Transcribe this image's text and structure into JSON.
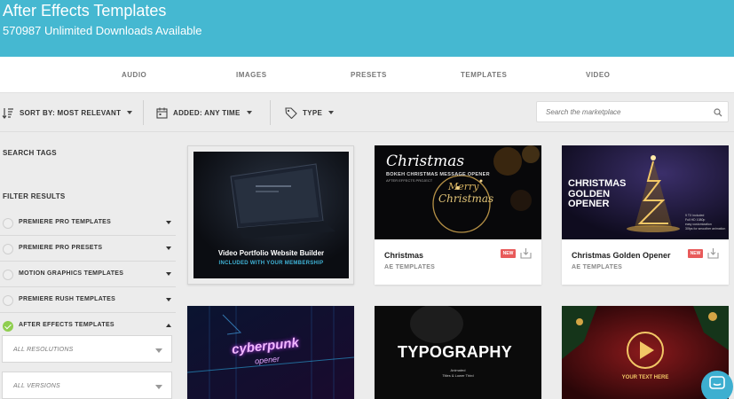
{
  "header": {
    "title": "After Effects Templates",
    "subtitle": "570987 Unlimited Downloads Available"
  },
  "nav": [
    "AUDIO",
    "IMAGES",
    "PRESETS",
    "TEMPLATES",
    "VIDEO"
  ],
  "toolbar": {
    "sort_label": "SORT BY: MOST RELEVANT",
    "added_label": "ADDED: ANY TIME",
    "type_label": "TYPE",
    "search_placeholder": "Search the marketplace"
  },
  "sidebar": {
    "search_tags": "SEARCH TAGS",
    "filter_results": "FILTER RESULTS",
    "filters": [
      {
        "label": "PREMIERE PRO TEMPLATES",
        "checked": false
      },
      {
        "label": "PREMIERE PRO PRESETS",
        "checked": false
      },
      {
        "label": "MOTION GRAPHICS TEMPLATES",
        "checked": false
      },
      {
        "label": "PREMIERE RUSH TEMPLATES",
        "checked": false
      },
      {
        "label": "AFTER EFFECTS TEMPLATES",
        "checked": true
      }
    ],
    "resolutions": "ALL RESOLUTIONS",
    "versions": "ALL VERSIONS"
  },
  "cards": {
    "promo": {
      "title": "Video Portfolio Website Builder",
      "subtitle": "INCLUDED WITH YOUR MEMBERSHIP"
    },
    "christmas": {
      "thumb_title": "Christmas",
      "thumb_line1": "BOKEH CHRISTMAS MESSAGE OPENER",
      "thumb_line2": "AFTER EFFECTS PROJECT",
      "thumb_script1": "Merry",
      "thumb_script2": "Christmas",
      "title": "Christmas",
      "category": "AE TEMPLATES",
      "badge": "NEW"
    },
    "golden": {
      "thumb_line1": "CHRISTMAS",
      "thumb_line2": "GOLDEN",
      "thumb_line3": "OPENER",
      "thumb_notes": [
        "9 TX included",
        "Full HD 1080p",
        "easy customization",
        "30fps for smoother animation"
      ],
      "title": "Christmas Golden Opener",
      "category": "AE TEMPLATES",
      "badge": "NEW"
    },
    "cyberpunk": {
      "line1": "cyberpunk",
      "line2": "opener"
    },
    "typography": {
      "title": "TYPOGRAPHY",
      "sub1": "Animated",
      "sub2": "Titles & Lower Third"
    },
    "yourtext": {
      "text": "YOUR TEXT HERE"
    }
  },
  "colors": {
    "header": "#45b8d1",
    "accent_green": "#8fce4f",
    "badge_red": "#e85a5a",
    "promo_blue": "#3fb3d6"
  }
}
